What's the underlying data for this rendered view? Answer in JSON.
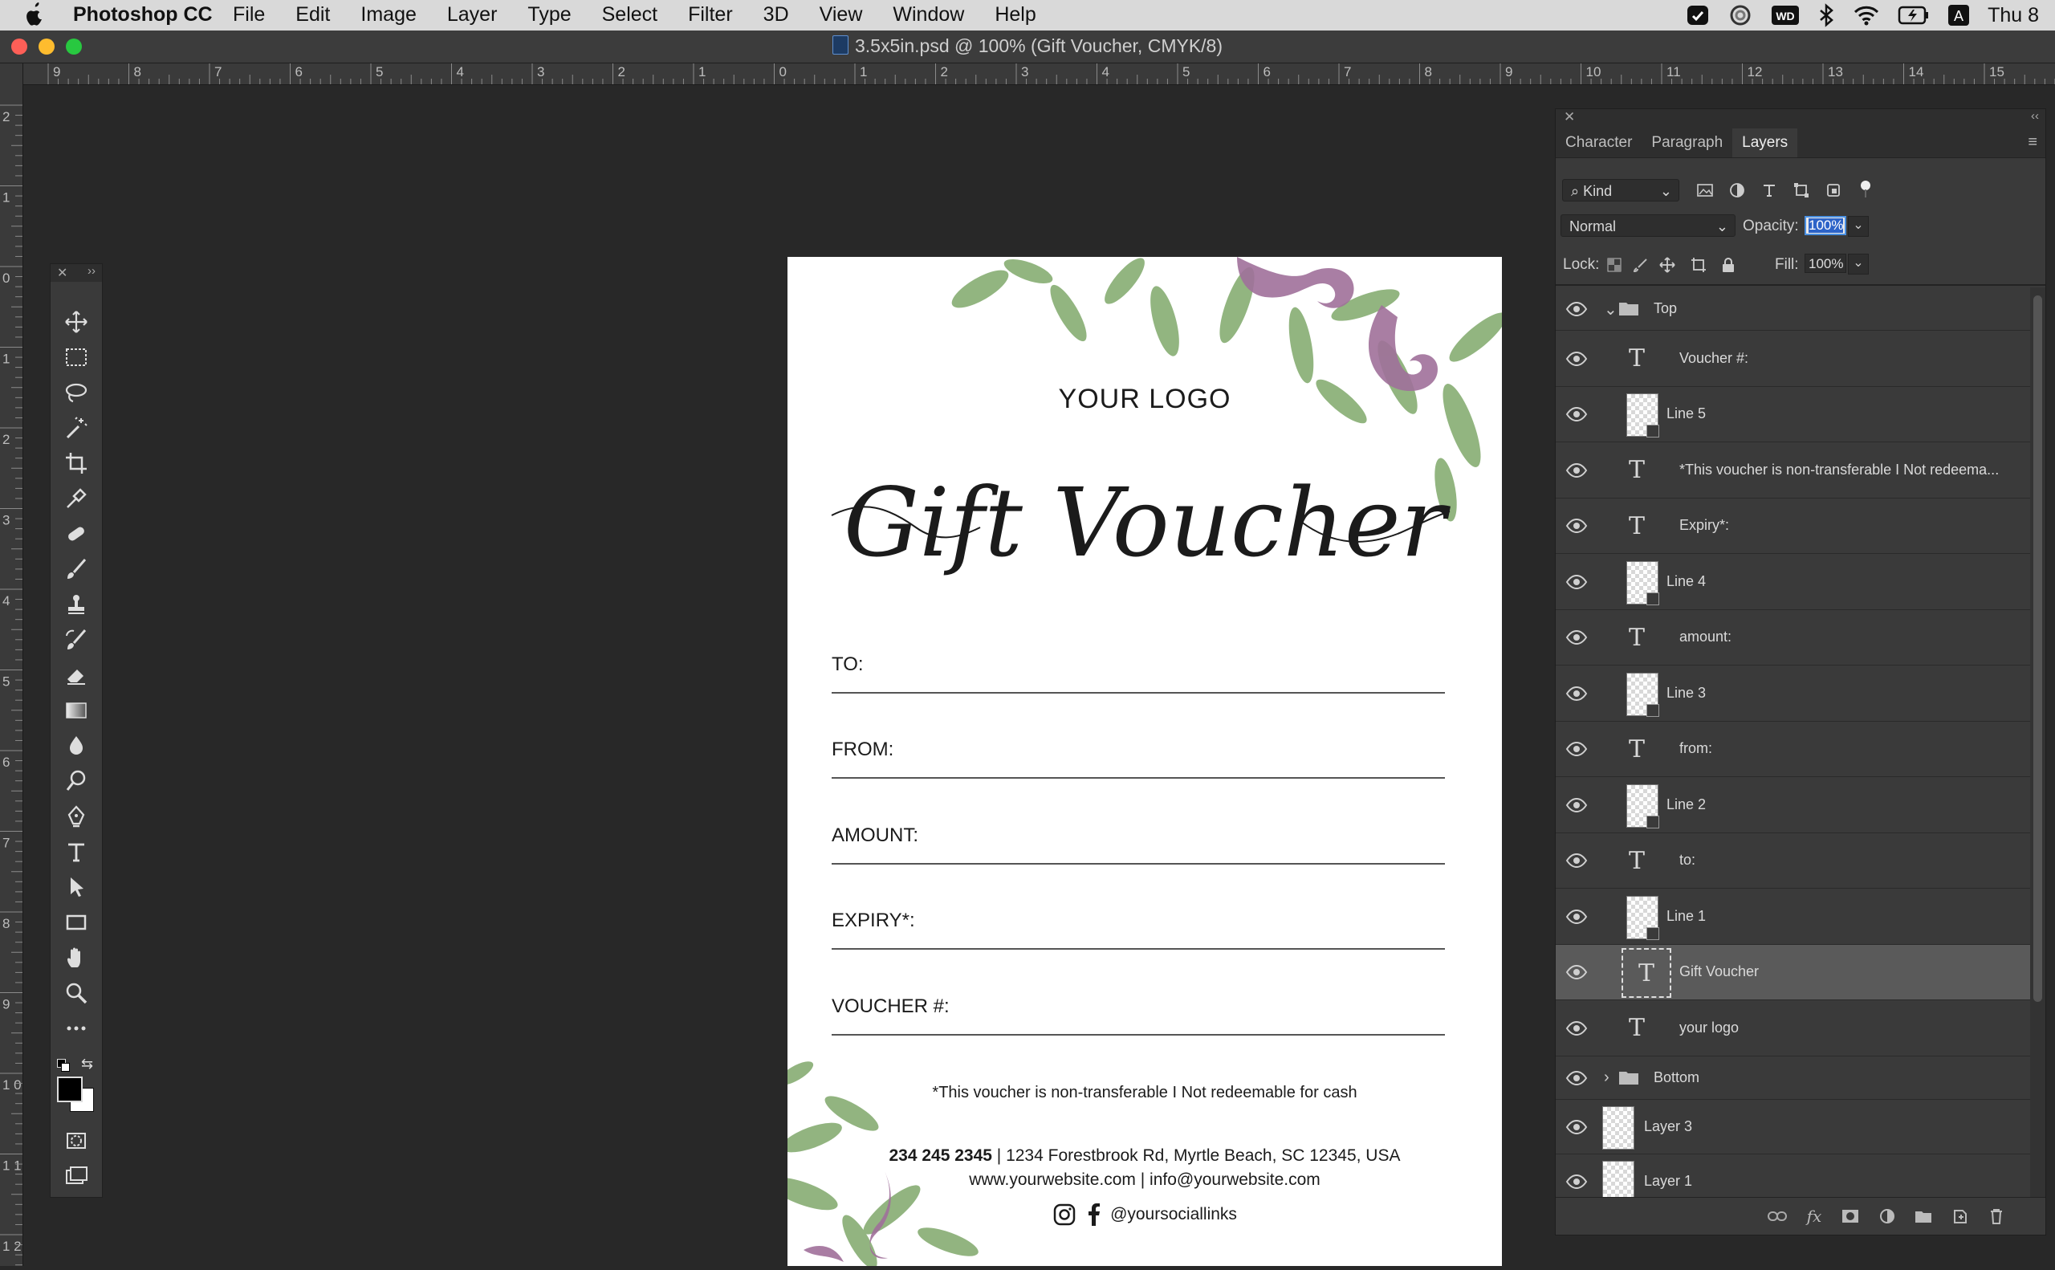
{
  "menubar": {
    "app_name": "Photoshop CC",
    "menus": [
      "File",
      "Edit",
      "Image",
      "Layer",
      "Type",
      "Select",
      "Filter",
      "3D",
      "View",
      "Window",
      "Help"
    ],
    "clock": "Thu 8",
    "status_icons": [
      "creative-cloud-icon",
      "cc-libraries-icon",
      "wd-drive-icon",
      "bluetooth-icon",
      "wifi-icon",
      "battery-icon",
      "input-source-icon"
    ]
  },
  "window": {
    "title": "3.5x5in.psd @ 100% (Gift Voucher, CMYK/8)"
  },
  "rulers": {
    "horizontal_labels": [
      "9",
      "8",
      "7",
      "6",
      "5",
      "4",
      "3",
      "2",
      "1",
      "0",
      "1",
      "2",
      "3",
      "4",
      "5",
      "6",
      "7",
      "8",
      "9",
      "10",
      "11",
      "12",
      "13",
      "14",
      "15"
    ],
    "vertical_labels": [
      "2",
      "1",
      "0",
      "1",
      "2",
      "3",
      "4",
      "5",
      "6",
      "7",
      "8",
      "9",
      "1 0",
      "1 1",
      "1 2"
    ]
  },
  "tools": {
    "items": [
      "move-tool",
      "marquee-tool",
      "lasso-tool",
      "magic-wand-tool",
      "crop-tool",
      "eyedropper-tool",
      "healing-brush-tool",
      "brush-tool",
      "clone-stamp-tool",
      "history-brush-tool",
      "eraser-tool",
      "gradient-tool",
      "blur-tool",
      "dodge-tool",
      "pen-tool",
      "type-tool",
      "path-selection-tool",
      "rectangle-tool",
      "hand-tool",
      "zoom-tool",
      "more-tools"
    ],
    "foreground_color": "#000000",
    "background_color": "#ffffff"
  },
  "document": {
    "logo": "YOUR LOGO",
    "script_title": "Gift Voucher",
    "fields": [
      "TO:",
      "FROM:",
      "AMOUNT:",
      "EXPIRY*:",
      "VOUCHER #:"
    ],
    "disclaimer": "*This voucher is non-transferable I Not redeemable for cash",
    "phone": "234 245 2345",
    "address": " | 1234 Forestbrook Rd, Myrtle Beach, SC 12345, USA",
    "web_line": "www.yourwebsite.com | info@yourwebsite.com",
    "social": "@yoursociallinks",
    "leaf_color": "#7fa86a",
    "ribbon_color": "#a0709a"
  },
  "panel": {
    "tabs": [
      "Character",
      "Paragraph",
      "Layers"
    ],
    "active_tab": "Layers",
    "filter_kind": "Kind",
    "blend_mode": "Normal",
    "opacity_label": "Opacity:",
    "opacity_value": "100%",
    "lock_label": "Lock:",
    "fill_label": "Fill:",
    "fill_value": "100%",
    "layers": [
      {
        "name": "Top",
        "type": "group-open",
        "level": 0
      },
      {
        "name": "Voucher #:",
        "type": "text",
        "level": 1
      },
      {
        "name": "Line 5",
        "type": "image",
        "level": 1
      },
      {
        "name": "*This voucher is non-transferable I Not redeema...",
        "type": "text",
        "level": 1
      },
      {
        "name": "Expiry*:",
        "type": "text",
        "level": 1
      },
      {
        "name": "Line 4",
        "type": "image",
        "level": 1
      },
      {
        "name": "amount:",
        "type": "text",
        "level": 1
      },
      {
        "name": "Line 3",
        "type": "image",
        "level": 1
      },
      {
        "name": "from:",
        "type": "text",
        "level": 1
      },
      {
        "name": "Line 2",
        "type": "image",
        "level": 1
      },
      {
        "name": "to:",
        "type": "text",
        "level": 1
      },
      {
        "name": "Line 1",
        "type": "image",
        "level": 1
      },
      {
        "name": "Gift Voucher",
        "type": "text",
        "level": 1,
        "selected": true
      },
      {
        "name": "your logo",
        "type": "text",
        "level": 1
      },
      {
        "name": "Bottom",
        "type": "group-closed",
        "level": 0
      },
      {
        "name": "Layer 3",
        "type": "image",
        "level": 0
      },
      {
        "name": "Layer 1",
        "type": "image",
        "level": 0
      }
    ]
  }
}
